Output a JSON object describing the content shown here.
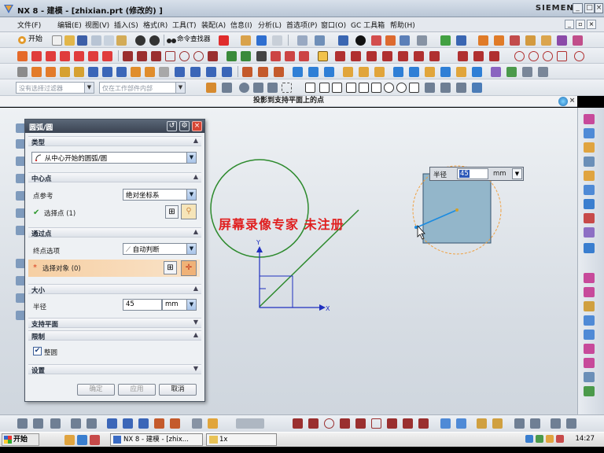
{
  "window": {
    "title": "NX 8 - 建模 - [zhixian.prt (修改的) ]",
    "brand": "SIEMENS",
    "controls": [
      "_",
      "□",
      "×"
    ]
  },
  "menu": {
    "items": [
      "文件(F)",
      "编辑(E)",
      "视图(V)",
      "插入(S)",
      "格式(R)",
      "工具(T)",
      "装配(A)",
      "信息(I)",
      "分析(L)",
      "首选项(P)",
      "窗口(O)",
      "GC 工具箱",
      "帮助(H)"
    ]
  },
  "toolbar": {
    "start_label": "开始",
    "command_finder": "命令查找器"
  },
  "selection_bar": {
    "filter_placeholder": "没有选择过滤器",
    "scope": "仅在工作部件内部"
  },
  "status_line": {
    "text": "投影到支持平面上的点"
  },
  "watermark": "屏幕录像专家   未注册",
  "dialog": {
    "title": "圆弧/圆",
    "sections": {
      "type": "类型",
      "center": "中心点",
      "through": "通过点",
      "size": "大小",
      "support": "支持平面",
      "limits": "限制",
      "settings": "设置"
    },
    "type_value": "从中心开始的圆弧/圆",
    "center_ref_label": "点参考",
    "center_ref_value": "绝对坐标系",
    "center_select": "选择点 (1)",
    "endpoint_label": "终点选项",
    "endpoint_value": "自动判断",
    "select_object": "选择对象 (0)",
    "radius_label": "半径",
    "radius_value": "45",
    "radius_unit": "mm",
    "full_circle": "整圆",
    "buttons": {
      "ok": "确定",
      "apply": "应用",
      "cancel": "取消"
    }
  },
  "radius_popup": {
    "label": "半径",
    "value": "45",
    "unit": "mm"
  },
  "axis": {
    "x": "X",
    "y": "Y"
  },
  "taskbar": {
    "start": "开始",
    "tasks": [
      "NX 8 - 建模 - [zhix...",
      "1x"
    ],
    "clock": "14:27"
  },
  "colors": {
    "circle": "#2d8a2d",
    "axis": "#1f2fbf",
    "preview_circle": "#f0a040",
    "preview_plane": "#8fb4c9",
    "watermark": "#e02020"
  }
}
